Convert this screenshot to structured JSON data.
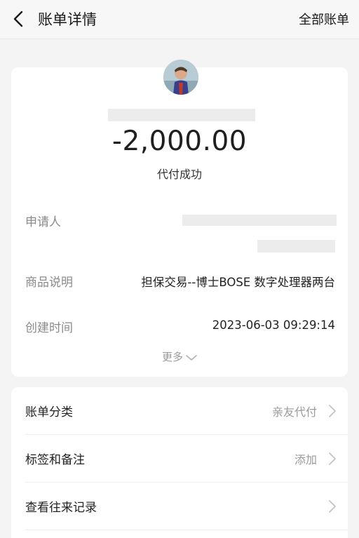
{
  "nav": {
    "title": "账单详情",
    "right_label": "全部账单"
  },
  "bill": {
    "amount": "-2,000.00",
    "status": "代付成功",
    "rows": [
      {
        "label": "申请人",
        "value": ""
      },
      {
        "label": "商品说明",
        "value": "担保交易--博士BOSE 数字处理器两台"
      },
      {
        "label": "创建时间",
        "value": "2023-06-03 09:29:14"
      }
    ],
    "more_label": "更多"
  },
  "options": [
    {
      "label": "账单分类",
      "value": "亲友代付"
    },
    {
      "label": "标签和备注",
      "value": "添加"
    },
    {
      "label": "查看往来记录",
      "value": ""
    }
  ],
  "colors": {
    "background": "#f4f4f4",
    "card": "#ffffff",
    "muted_text": "#8a8a8a",
    "redaction": "#ececec"
  },
  "icons": [
    "back-arrow-icon",
    "chevron-down-icon",
    "chevron-right-icon"
  ]
}
